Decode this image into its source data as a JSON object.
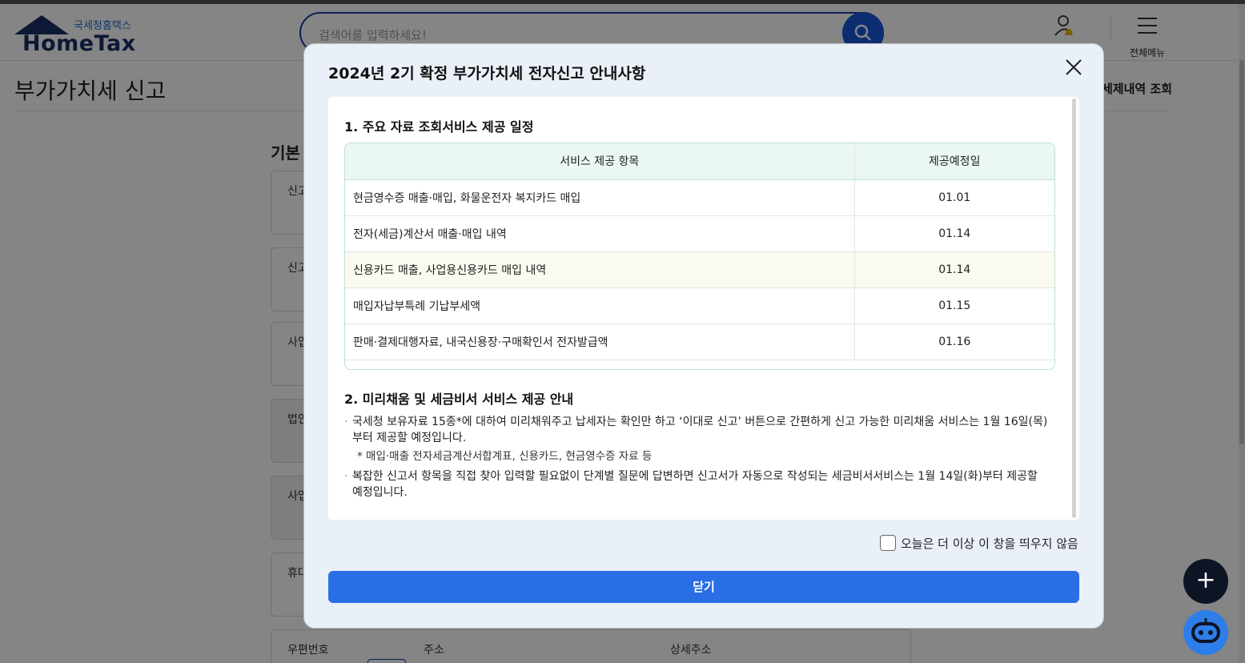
{
  "header": {
    "logo_sub": "국세청홈택스",
    "logo_main": "HomeTax",
    "search_placeholder": "검색어를 입력하세요!",
    "menu_label": "전체메뉴"
  },
  "page": {
    "title": "부가가치세 신고",
    "link": "세제내역 조회",
    "section_title": "기본",
    "fields": [
      "신고",
      "신고",
      "사업",
      "법인",
      "사업",
      "휴대"
    ],
    "addr_labels": [
      "우편번호",
      "주소",
      "상세주소"
    ]
  },
  "modal": {
    "title": "2024년 2기 확정 부가가치세 전자신고 안내사항",
    "section1_title": "1. 주요 자료 조회서비스 제공 일정",
    "table": {
      "headers": [
        "서비스 제공 항목",
        "제공예정일"
      ],
      "rows": [
        {
          "item": "현금영수증 매출·매입, 화물운전자 복지카드 매입",
          "date": "01.01"
        },
        {
          "item": "전자(세금)계산서 매출·매입 내역",
          "date": "01.14"
        },
        {
          "item": "신용카드 매출, 사업용신용카드 매입 내역",
          "date": "01.14"
        },
        {
          "item": "매입자납부특례 기납부세액",
          "date": "01.15"
        },
        {
          "item": "판매·결제대행자료, 내국신용장·구매확인서 전자발급액",
          "date": "01.16"
        }
      ]
    },
    "section2_title": "2. 미리채움 및 세금비서 서비스 제공 안내",
    "note1": "국세청 보유자료 15종*에 대하여 미리채워주고 납세자는 확인만 하고 ‘이대로 신고’ 버튼으로 간편하게 신고 가능한 미리채움 서비스는 1월 16일(목)부터 제공할 예정입니다.",
    "note1_sub": "* 매입·매출 전자세금계산서합계표, 신용카드, 현금영수증 자료 등",
    "note2": "복잡한 신고서 항목을 직접 찾아 입력할 필요없이 단계별 질문에 답변하면 신고서가 자동으로 작성되는 세금비서서비스는 1월 14일(화)부터 제공할 예정입니다.",
    "dont_show_label": "오늘은 더 이상 이 창을 띄우지 않음",
    "close_label": "닫기"
  },
  "colors": {
    "primary": "#2a6ee6",
    "navy": "#1a2e67",
    "table_header_bg": "#eaf7f5",
    "highlight_row_bg": "#fbfaf0"
  }
}
